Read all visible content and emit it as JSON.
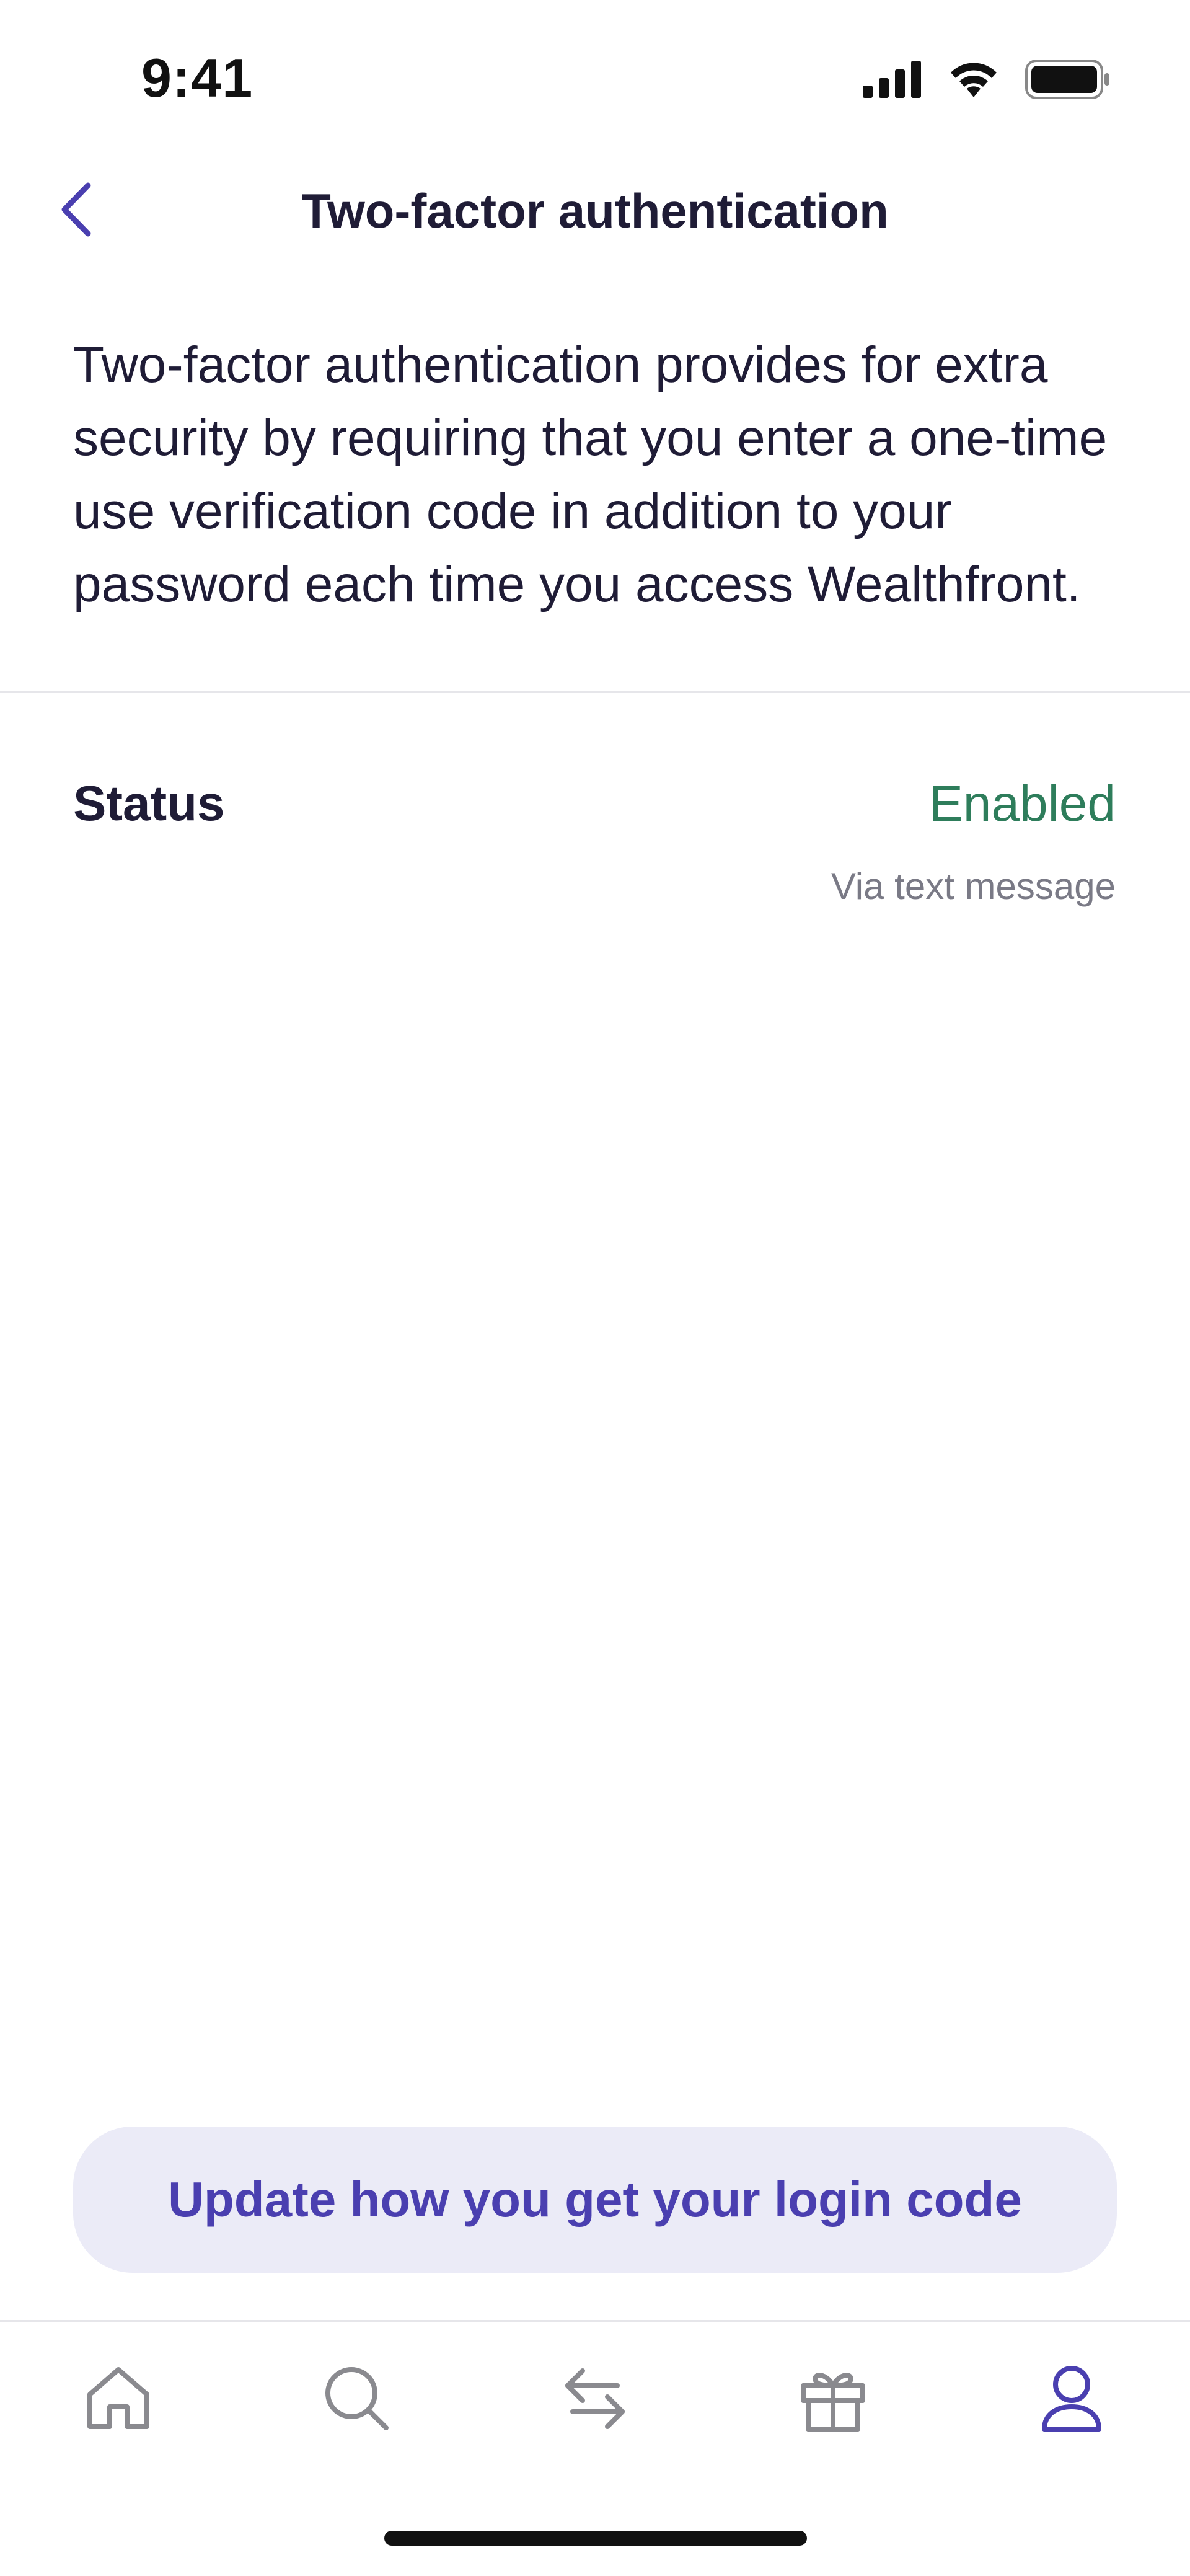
{
  "status_bar": {
    "time": "9:41",
    "icons": [
      "cellular-signal-icon",
      "wifi-icon",
      "battery-icon"
    ]
  },
  "header": {
    "title": "Two-factor authentication",
    "back_icon": "chevron-left-icon"
  },
  "description": "Two-factor authentication provides for extra security by requiring that you enter a one-time use verification code in addition to your password each time you access Wealthfront.",
  "status": {
    "label": "Status",
    "value": "Enabled",
    "method": "Via text message"
  },
  "primary_action": {
    "label": "Update how you get your login code"
  },
  "bottom_nav": {
    "items": [
      {
        "name": "home",
        "icon": "home-icon",
        "active": false
      },
      {
        "name": "search",
        "icon": "search-icon",
        "active": false
      },
      {
        "name": "transfer",
        "icon": "transfer-arrows-icon",
        "active": false
      },
      {
        "name": "rewards",
        "icon": "gift-icon",
        "active": false
      },
      {
        "name": "profile",
        "icon": "profile-icon",
        "active": true
      }
    ]
  },
  "colors": {
    "accent": "#4a3fb0",
    "enabled": "#2e7d5b",
    "button_bg": "#ebebf7",
    "text": "#1f1c36",
    "muted": "#7a7a86",
    "icon_inactive": "#8a8a8f"
  }
}
